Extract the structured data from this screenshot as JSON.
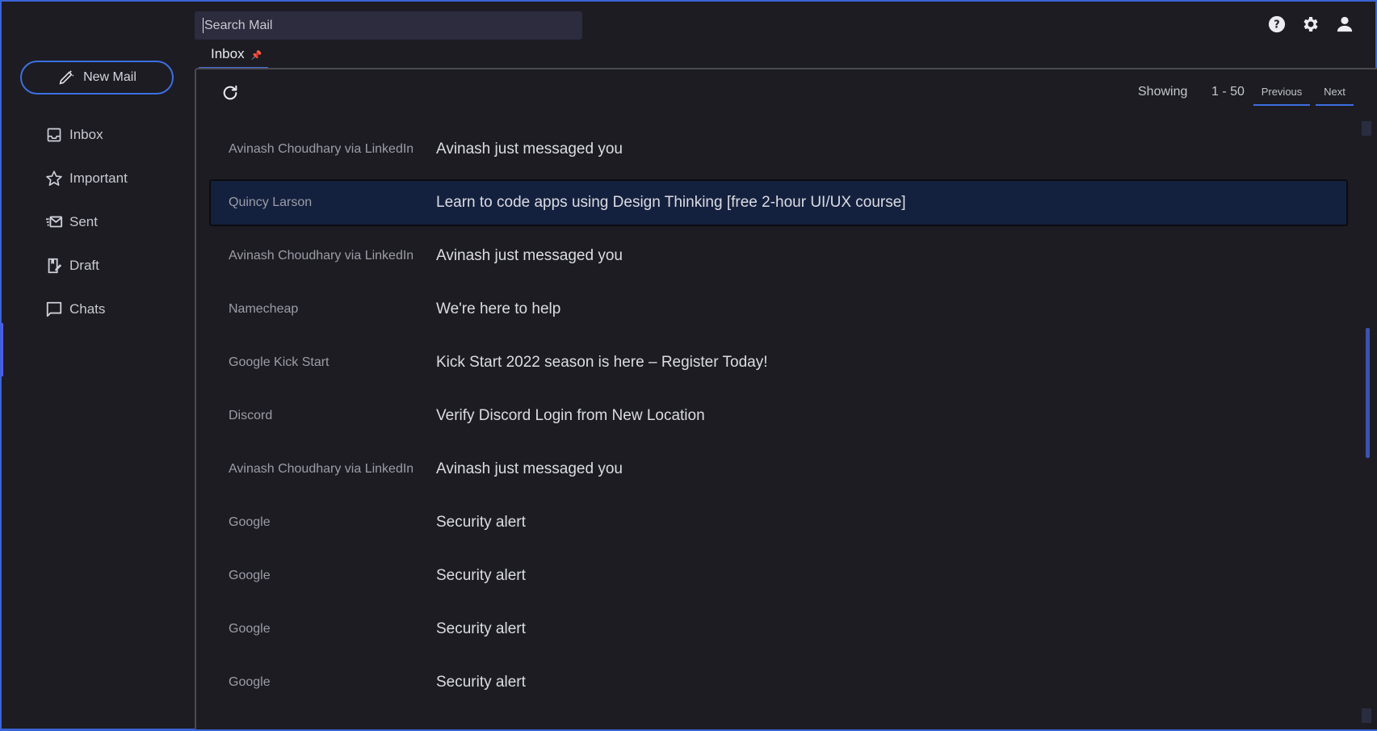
{
  "search": {
    "placeholder": "Search Mail"
  },
  "top_icons": [
    "help-icon",
    "gear-icon",
    "person-icon"
  ],
  "sidebar": {
    "new_mail_label": "New Mail",
    "items": [
      {
        "label": "Inbox",
        "icon": "inbox-icon"
      },
      {
        "label": "Important",
        "icon": "star-icon"
      },
      {
        "label": "Sent",
        "icon": "sent-mail-icon"
      },
      {
        "label": "Draft",
        "icon": "draft-icon"
      },
      {
        "label": "Chats",
        "icon": "chat-icon"
      }
    ]
  },
  "tab": {
    "label": "Inbox",
    "pin_icon": "pin-icon"
  },
  "toolbar": {
    "showing_label": "Showing",
    "range": "1 - 50",
    "previous_label": "Previous",
    "next_label": "Next"
  },
  "mails": [
    {
      "from": "Avinash Choudhary via LinkedIn",
      "subject": "Avinash just messaged you",
      "selected": false
    },
    {
      "from": "Quincy Larson",
      "subject": "Learn to code apps using Design Thinking [free 2-hour UI/UX course]",
      "selected": true
    },
    {
      "from": "Avinash Choudhary via LinkedIn",
      "subject": "Avinash just messaged you",
      "selected": false
    },
    {
      "from": "Namecheap",
      "subject": "We're here to help",
      "selected": false
    },
    {
      "from": "Google Kick Start",
      "subject": "Kick Start 2022 season is here – Register Today!",
      "selected": false
    },
    {
      "from": "Discord",
      "subject": "Verify Discord Login from New Location",
      "selected": false
    },
    {
      "from": "Avinash Choudhary via LinkedIn",
      "subject": "Avinash just messaged you",
      "selected": false
    },
    {
      "from": "Google",
      "subject": "Security alert",
      "selected": false
    },
    {
      "from": "Google",
      "subject": "Security alert",
      "selected": false
    },
    {
      "from": "Google",
      "subject": "Security alert",
      "selected": false
    },
    {
      "from": "Google",
      "subject": "Security alert",
      "selected": false
    }
  ],
  "colors": {
    "accent": "#3d6fe0",
    "background": "#1c1c22",
    "selected_row": "#14213e",
    "search_bg": "#2c2c3e"
  }
}
